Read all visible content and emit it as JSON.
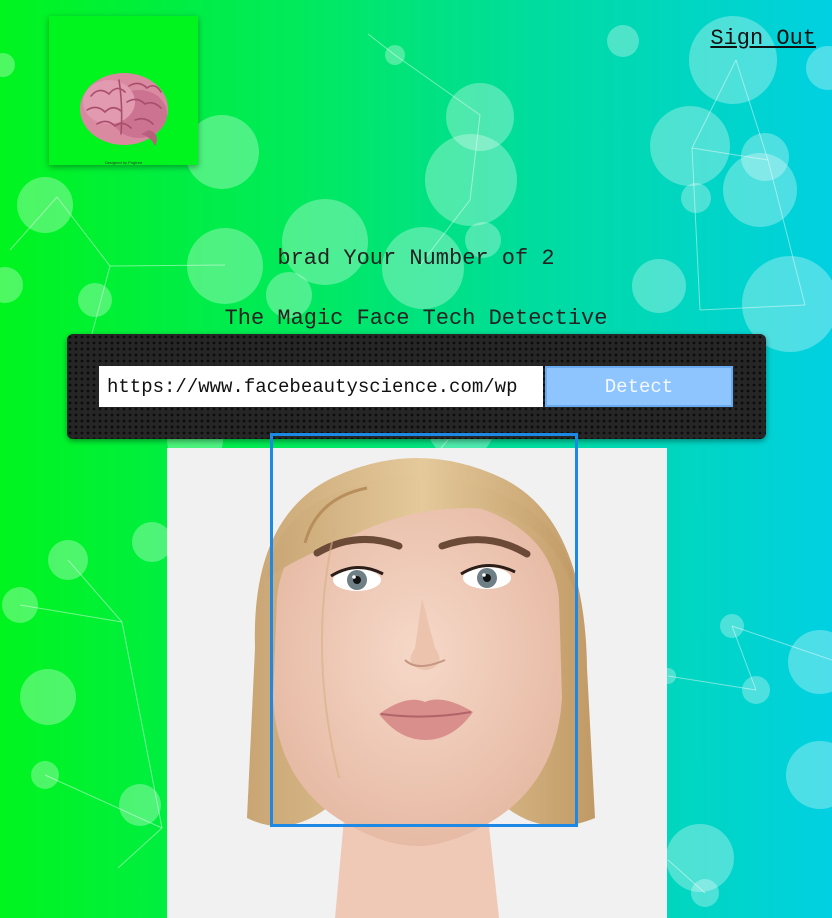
{
  "header": {
    "signout_label": "Sign Out",
    "logo_caption": "Designed by Pngtree"
  },
  "rank": {
    "text": "brad Your Number of 2"
  },
  "app": {
    "title": "The Magic Face Tech Detective"
  },
  "form": {
    "url_value": "https://www.facebeautyscience.com/wp",
    "detect_label": "Detect"
  },
  "colors": {
    "gradient_left": "#00f51e",
    "gradient_right": "#00d0e2",
    "button_bg": "#8ec5ff",
    "face_box": "#1e88e5",
    "panel_bg": "#262626"
  },
  "icons": {
    "logo": "brain-icon"
  }
}
